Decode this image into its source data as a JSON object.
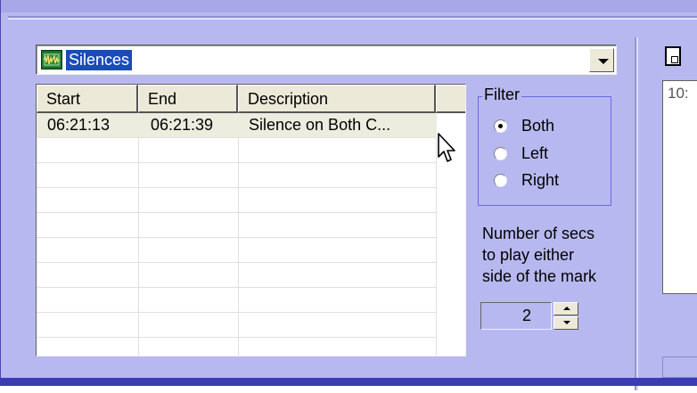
{
  "colors": {
    "window_bg": "#b8b8f0",
    "selection": "#1a4cb8",
    "row_selected": "#ececdf"
  },
  "combo": {
    "icon": "waveform-icon",
    "value": "Silences"
  },
  "table": {
    "columns": [
      "Start",
      "End",
      "Description"
    ],
    "rows": [
      {
        "start": "06:21:13",
        "end": "06:21:39",
        "description": "Silence on Both C..."
      }
    ]
  },
  "filter": {
    "title": "Filter",
    "options": [
      "Both",
      "Left",
      "Right"
    ],
    "selected": "Both"
  },
  "secs": {
    "label_line1": "Number of secs",
    "label_line2": "to play either",
    "label_line3": "side of the mark",
    "value": "2"
  },
  "right_panel": {
    "icon": "document-icon",
    "text": "10:"
  }
}
